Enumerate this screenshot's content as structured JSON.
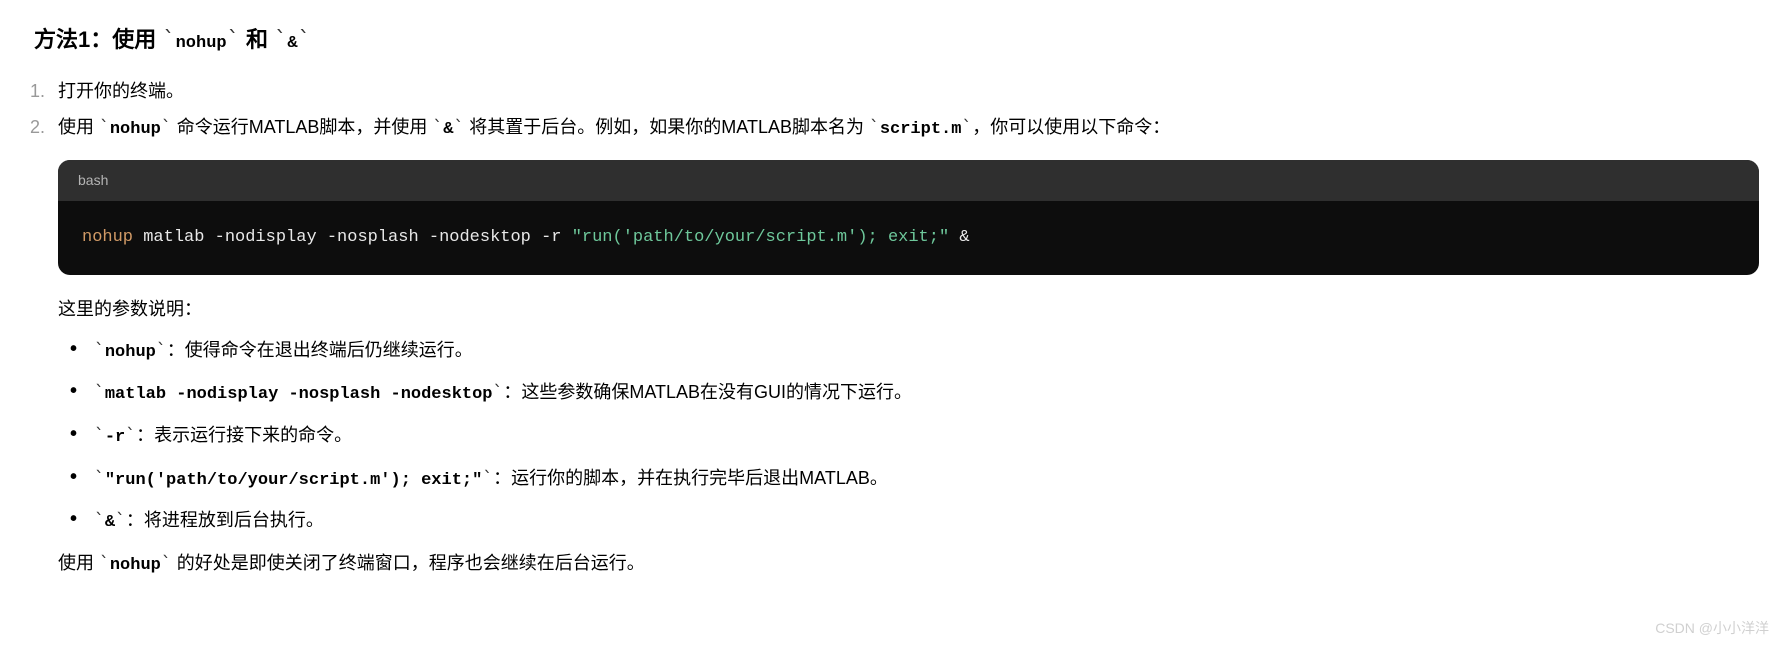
{
  "heading": {
    "prefix": "方法1：使用 ",
    "code1": "nohup",
    "mid": " 和 ",
    "code2": "&"
  },
  "steps": {
    "s1": "打开你的终端。",
    "s2": {
      "t1": "使用 ",
      "c1": "nohup",
      "t2": " 命令运行MATLAB脚本，并使用 ",
      "c2": "&",
      "t3": " 将其置于后台。例如，如果你的MATLAB脚本名为 ",
      "c3": "script.m",
      "t4": "，你可以使用以下命令："
    }
  },
  "code": {
    "lang": "bash",
    "cmd": "nohup",
    "body": " matlab -nodisplay -nosplash -nodesktop -r ",
    "str": "\"run('path/to/your/script.m'); exit;\"",
    "tail": " &"
  },
  "paramDesc": "这里的参数说明：",
  "bullets": {
    "b1": {
      "code": "nohup",
      "desc": "：使得命令在退出终端后仍继续运行。"
    },
    "b2": {
      "code": "matlab -nodisplay -nosplash -nodesktop",
      "desc": "：这些参数确保MATLAB在没有GUI的情况下运行。"
    },
    "b3": {
      "code": "-r",
      "desc": "：表示运行接下来的命令。"
    },
    "b4": {
      "code": "\"run('path/to/your/script.m'); exit;\"",
      "desc": "：运行你的脚本，并在执行完毕后退出MATLAB。"
    },
    "b5": {
      "code": "&",
      "desc": "：将进程放到后台执行。"
    }
  },
  "closing": {
    "t1": "使用 ",
    "c1": "nohup",
    "t2": " 的好处是即使关闭了终端窗口，程序也会继续在后台运行。"
  },
  "watermark": "CSDN @小小洋洋",
  "tick": "`"
}
